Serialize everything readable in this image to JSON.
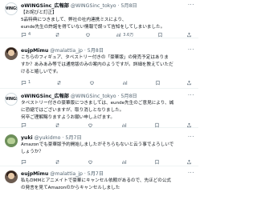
{
  "posts": [
    {
      "name": "oWINGSinc_広報部",
      "handle": "@WINGSinc_tokyo",
      "sep": "·",
      "date": "5月8日",
      "lines": [
        "【お詫びと訂正】",
        "5品特典につきまして、弊社の社内連携ミスにより、",
        "eunde先生の許諾を得ていない情報で誤って告知をしてしまいました。"
      ],
      "actions": {
        "reply": "4",
        "repost": "",
        "like": "",
        "views": "3.6万"
      }
    },
    {
      "name": "eujpMimu",
      "handle": "@malattia_jp",
      "sep": "·",
      "date": "5月8日",
      "lines": [
        "こちらのフィギュア、タペストリー付きの「豪華版」の発売予定はありま",
        "すか？あみあみ等では通常版のみの案内のようですが。詳細を教えていただ",
        "けると嬉しいです。"
      ],
      "actions": {
        "reply": "1",
        "repost": "",
        "like": "",
        "views": ""
      }
    },
    {
      "name": "oWINGSinc_広報部",
      "handle": "@WINGSinc_tokyo",
      "sep": "·",
      "date": "5月8日",
      "lines": [
        "タペストリー付きの豪華版につきましては、eunde先生のご意見により、誠",
        "に恐縮ではございますが、取り消しとなりました。",
        "何卒ご理解賜りますようお願い申し上げます。"
      ],
      "actions": {
        "reply": "",
        "repost": "",
        "like": "",
        "views": ""
      }
    },
    {
      "name": "yuki",
      "handle": "@yukidmo",
      "sep": "·",
      "date": "5月7日",
      "lines": [
        "Amazonでも豪華版予約開始しましたがそちらもないと云う事でよろしいで",
        "しょうか？"
      ],
      "actions": {
        "reply": "",
        "repost": "",
        "like": "",
        "views": ""
      }
    },
    {
      "name": "eujpMimu",
      "handle": "@malattia_jp",
      "sep": "·",
      "date": "5月7日",
      "lines": [
        "私もDMMとアニメイトで豪華にキャンセル依頼があるので、先ほどの公式",
        "の発言を見てAmazonのからキャンセルしました"
      ],
      "actions": {
        "reply": "",
        "repost": "",
        "like": "",
        "views": ""
      }
    }
  ],
  "icons": {
    "more": "more-horizontal-icon",
    "reply": "reply-icon",
    "repost": "repost-icon",
    "like": "like-icon",
    "views": "views-icon",
    "bookmark": "bookmark-icon",
    "share": "share-icon"
  },
  "colors": {
    "text": "#0f1419",
    "muted": "#536471",
    "divider": "#eff3f4",
    "background": "#ffffff"
  }
}
